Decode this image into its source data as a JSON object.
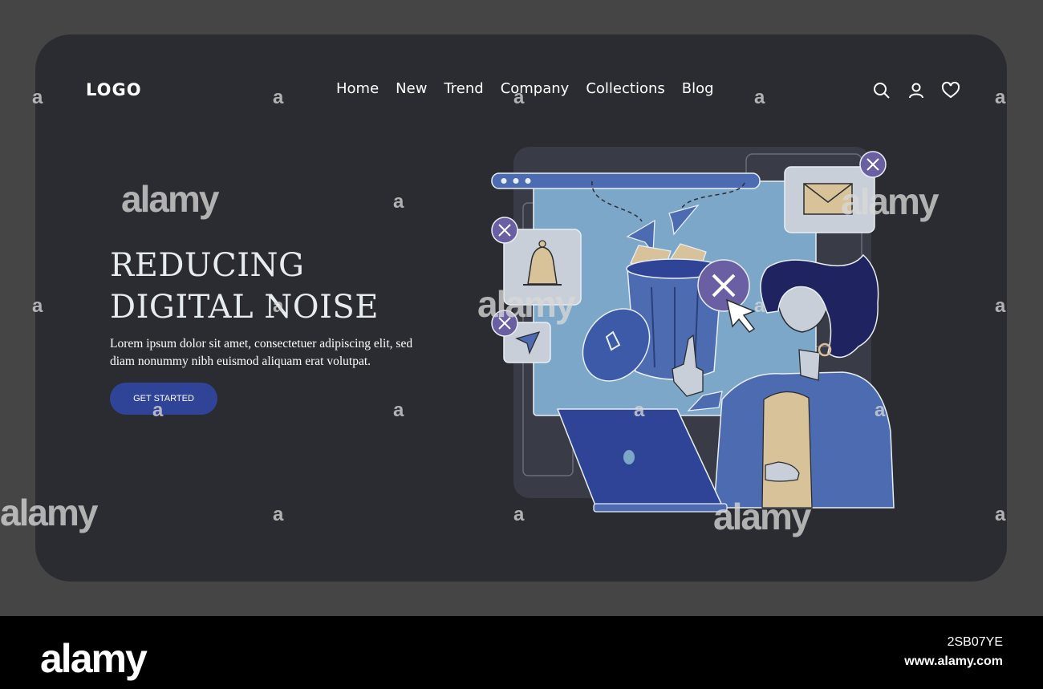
{
  "header": {
    "logo": "LOGO",
    "nav": [
      "Home",
      "New",
      "Trend",
      "Company",
      "Collections",
      "Blog"
    ],
    "icons": [
      "search-icon",
      "user-icon",
      "heart-icon"
    ]
  },
  "hero": {
    "headline_line1": "REDUCING",
    "headline_line2": "DIGITAL NOISE",
    "body": "Lorem ipsum dolor sit amet, consectetuer adipiscing elit, sed diam nonummy nibh euismod aliquam erat volutpat.",
    "cta_label": "GET STARTED"
  },
  "colors": {
    "page_bg": "#454546",
    "card_bg": "#2b2c31",
    "accent_blue": "#2f4497",
    "panel_blue": "#7ca7c9",
    "purple_badge": "#6b5fa3"
  },
  "watermark": {
    "text": "alamy",
    "small_text": "a",
    "image_id": "2SB07YE",
    "site": "www.alamy.com"
  }
}
